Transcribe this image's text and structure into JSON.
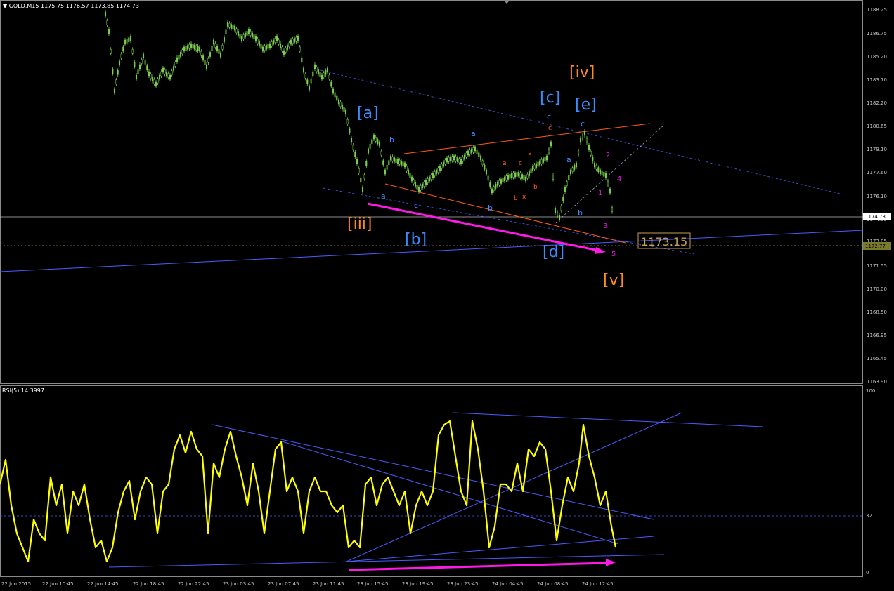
{
  "header": {
    "symbol": "GOLD,M15",
    "ohlc": "1175.75 1176.57 1173.85 1174.73",
    "indicator": "RSI(5) 14.3997"
  },
  "price_axis": {
    "ticks": [
      "1188.25",
      "1186.75",
      "1185.20",
      "1183.70",
      "1182.20",
      "1180.65",
      "1179.10",
      "1177.60",
      "1176.10",
      "1174.55",
      "1173.05",
      "1171.55",
      "1170.00",
      "1168.50",
      "1166.95",
      "1165.45",
      "1163.90"
    ],
    "current_price": "1174.73",
    "level_price": "1172.77",
    "target_label": "1173.15"
  },
  "rsi_axis": {
    "ticks": [
      "100",
      "32",
      "0"
    ]
  },
  "time_axis": {
    "ticks": [
      "22 Jun 2015",
      "22 Jun 10:45",
      "22 Jun 14:45",
      "22 Jun 18:45",
      "22 Jun 22:45",
      "23 Jun 03:45",
      "23 Jun 07:45",
      "23 Jun 11:45",
      "23 Jun 15:45",
      "23 Jun 19:45",
      "23 Jun 23:45",
      "24 Jun 04:45",
      "24 Jun 08:45",
      "24 Jun 12:45"
    ]
  },
  "waves": {
    "major": {
      "iii": "[iii]",
      "iv": "[iv]",
      "v": "[v]"
    },
    "intermediate": {
      "a": "[a]",
      "b": "[b]",
      "c": "[c]",
      "d": "[d]",
      "e": "[e]"
    },
    "minor_blue": [
      "b",
      "a",
      "a",
      "c",
      "b",
      "c",
      "a",
      "b",
      "c"
    ],
    "minor_red": [
      "c",
      "a",
      "a",
      "c",
      "b",
      "x",
      "b"
    ],
    "minor_magenta": [
      "2",
      "4",
      "1",
      "3",
      "5"
    ]
  },
  "colors": {
    "background": "#000000",
    "candle": "#7cd34a",
    "rsi_line": "#ffff00",
    "trendline_blue": "#4a5cff",
    "trendline_orange": "#ff5a14",
    "arrow_magenta": "#ff19e6",
    "label_orange": "#ff8c19",
    "label_blue": "#3c8cff"
  }
}
